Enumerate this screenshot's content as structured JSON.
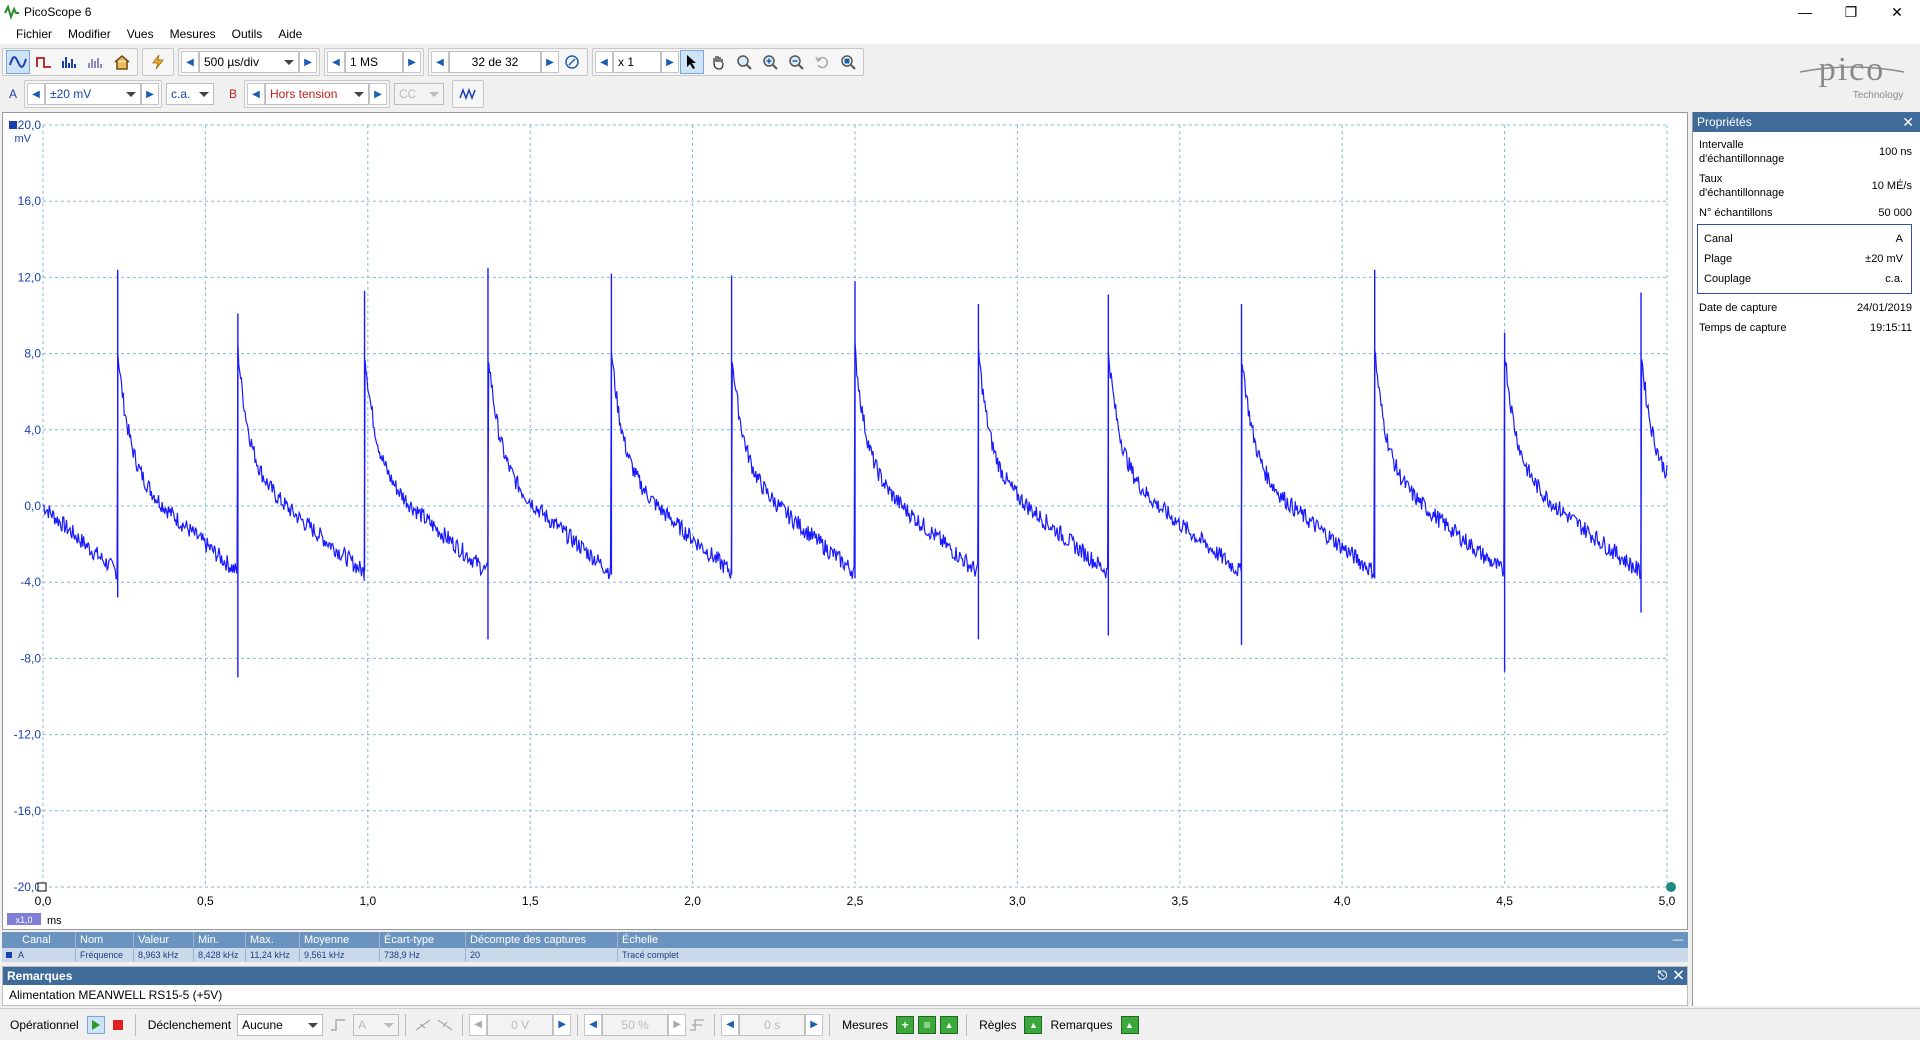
{
  "window": {
    "title": "PicoScope 6"
  },
  "menu": [
    "Fichier",
    "Modifier",
    "Vues",
    "Mesures",
    "Outils",
    "Aide"
  ],
  "toolbar": {
    "timebase": "500 µs/div",
    "samples": "1 MS",
    "capture_index": "32 de 32",
    "zoom": "x 1"
  },
  "channel_bar": {
    "a_label": "A",
    "a_range": "±20 mV",
    "a_coupling": "c.a.",
    "b_label": "B",
    "b_range": "Hors tension",
    "b_coupling": "CC"
  },
  "logo": {
    "text": "pico",
    "sub": "Technology"
  },
  "scope": {
    "y_unit": "mV",
    "x_unit": "ms",
    "x_scale_badge": "x1,0",
    "y_ticks": [
      "20,0",
      "16,0",
      "12,0",
      "8,0",
      "4,0",
      "0,0",
      "-4,0",
      "-8,0",
      "-12,0",
      "-16,0",
      "-20,0"
    ],
    "x_ticks": [
      "0,0",
      "0,5",
      "1,0",
      "1,5",
      "2,0",
      "2,5",
      "3,0",
      "3,5",
      "4,0",
      "4,5",
      "5,0"
    ],
    "trace_color": "#1a1aff",
    "grid_color": "#7fbcd8"
  },
  "chart_data": {
    "type": "line",
    "xlabel": "ms",
    "ylabel": "mV",
    "xlim": [
      0,
      5.0
    ],
    "ylim": [
      -20,
      20
    ],
    "grid": true,
    "series": [
      {
        "name": "A",
        "spike_times_ms": [
          0.23,
          0.6,
          0.99,
          1.37,
          1.75,
          2.12,
          2.5,
          2.88,
          3.28,
          3.69,
          4.1,
          4.5,
          4.92
        ],
        "spike_peaks_mv": [
          12.4,
          10.1,
          11.3,
          12.5,
          12.2,
          12.1,
          11.8,
          10.6,
          11.1,
          10.6,
          12.4,
          9.1,
          11.2
        ],
        "spike_mins_mv": [
          -4.8,
          -9.0,
          -3.4,
          -7.0,
          -3.6,
          -3.6,
          -3.8,
          -7.0,
          -6.8,
          -7.3,
          -3.8,
          -8.7,
          -5.6
        ],
        "post_spike_mv": 8.2,
        "pre_spike_mv": -3.5
      }
    ]
  },
  "properties": {
    "title": "Propriétés",
    "rows": [
      {
        "label": "Intervalle d'échantillonnage",
        "value": "100 ns"
      },
      {
        "label": "Taux d'échantillonnage",
        "value": "10 MÉ/s"
      },
      {
        "label": "N° échantillons",
        "value": "50 000"
      }
    ],
    "channel_box": [
      {
        "label": "Canal",
        "value": "A"
      },
      {
        "label": "Plage",
        "value": "±20 mV"
      },
      {
        "label": "Couplage",
        "value": "c.a."
      }
    ],
    "capture": [
      {
        "label": "Date de capture",
        "value": "24/01/2019"
      },
      {
        "label": "Temps de capture",
        "value": "19:15:11"
      }
    ]
  },
  "measurements": {
    "headers": [
      "Canal",
      "Nom",
      "Valeur",
      "Min.",
      "Max.",
      "Moyenne",
      "Écart-type",
      "Décompte des captures",
      "Échelle"
    ],
    "row": [
      "A",
      "Fréquence",
      "8,963 kHz",
      "8,428 kHz",
      "11,24 kHz",
      "9,561 kHz",
      "738,9 Hz",
      "20",
      "Tracé complet"
    ]
  },
  "remarks": {
    "title": "Remarques",
    "text": "Alimentation MEANWELL RS15-5 (+5V)"
  },
  "statusbar": {
    "mode": "Opérationnel",
    "trigger_label": "Déclenchement",
    "trigger_value": "Aucune",
    "trig_channel": "A",
    "trig_level": "0 V",
    "pretrigger": "50 %",
    "delay": "0 s",
    "measures": "Mesures",
    "rules": "Règles",
    "notes": "Remarques"
  }
}
